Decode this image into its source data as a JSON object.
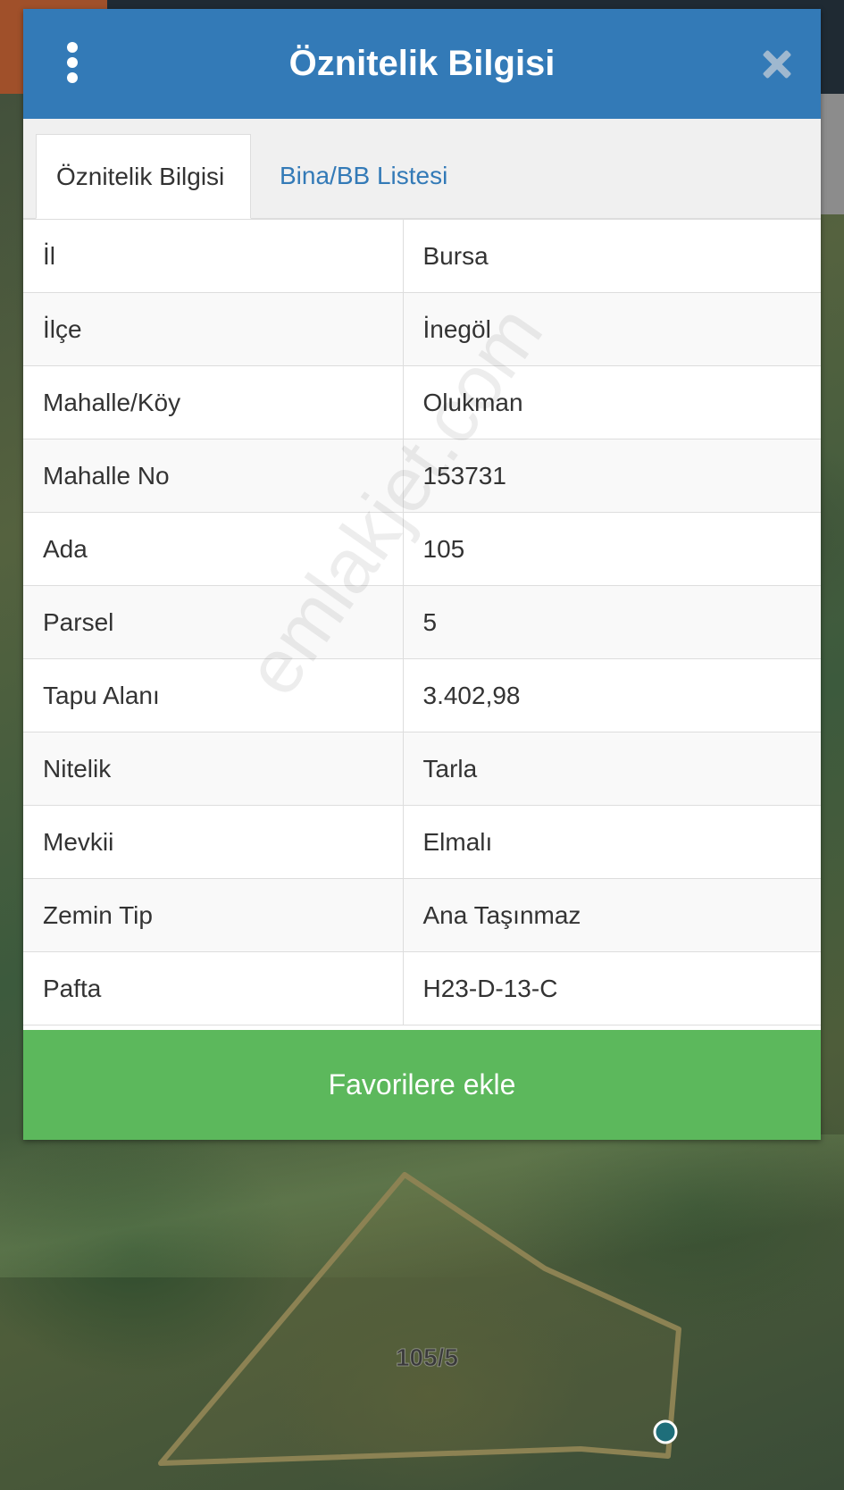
{
  "dialog": {
    "title": "Öznitelik Bilgisi",
    "header_color": "#337ab7",
    "menu_icon": "more-vertical-icon",
    "close_icon": "close-icon"
  },
  "tabs": [
    {
      "label": "Öznitelik Bilgisi",
      "active": true
    },
    {
      "label": "Bina/BB Listesi",
      "active": false
    }
  ],
  "attributes": [
    {
      "key": "İl",
      "value": "Bursa"
    },
    {
      "key": "İlçe",
      "value": "İnegöl"
    },
    {
      "key": "Mahalle/Köy",
      "value": "Olukman"
    },
    {
      "key": "Mahalle No",
      "value": "153731"
    },
    {
      "key": "Ada",
      "value": "105"
    },
    {
      "key": "Parsel",
      "value": "5"
    },
    {
      "key": "Tapu Alanı",
      "value": "3.402,98"
    },
    {
      "key": "Nitelik",
      "value": "Tarla"
    },
    {
      "key": "Mevkii",
      "value": "Elmalı"
    },
    {
      "key": "Zemin Tip",
      "value": "Ana Taşınmaz"
    },
    {
      "key": "Pafta",
      "value": "H23-D-13-C"
    }
  ],
  "favorite_button": {
    "label": "Favorilere ekle",
    "color": "#5cb85c"
  },
  "watermark": "emlakjet.com",
  "map": {
    "parcel_label": "105/5",
    "parcel_outline_color": "#8c8253",
    "marker_color": "#1e6e7a"
  }
}
